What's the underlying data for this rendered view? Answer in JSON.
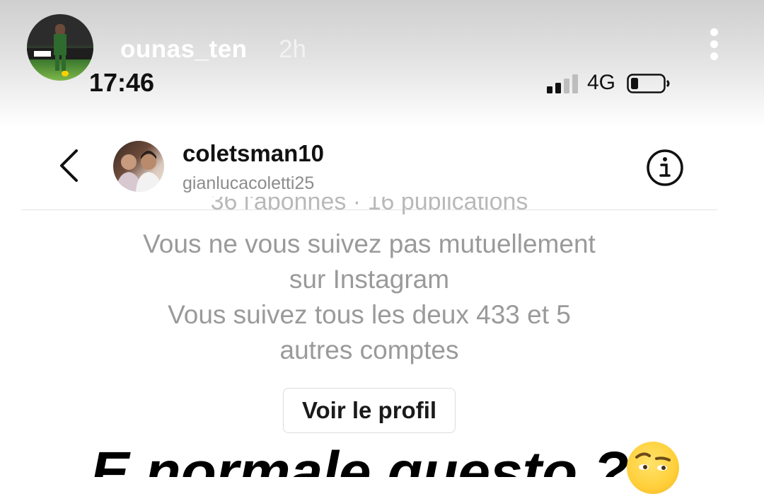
{
  "story": {
    "username": "ounas_ten",
    "time_ago": "2h",
    "more_icon": "more-vertical-icon"
  },
  "status_bar": {
    "clock": "17:46",
    "network": "4G",
    "signal_icon": "signal-bars-icon",
    "battery_icon": "battery-low-icon"
  },
  "dm": {
    "name": "coletsman10",
    "handle": "gianlucacoletti25",
    "back_icon": "chevron-left-icon",
    "info_icon": "info-circle-icon",
    "stats_partial": "36 l'abonnés · 16 publications",
    "mutual_lines": [
      "Vous ne vous suivez pas mutuellement",
      "sur Instagram",
      "Vous suivez tous les deux 433 et 5",
      "autres comptes"
    ],
    "profile_button": "Voir le profil"
  },
  "caption": {
    "text": "E normale questo ?",
    "emoji_icon": "raised-eyebrow-emoji-icon"
  }
}
